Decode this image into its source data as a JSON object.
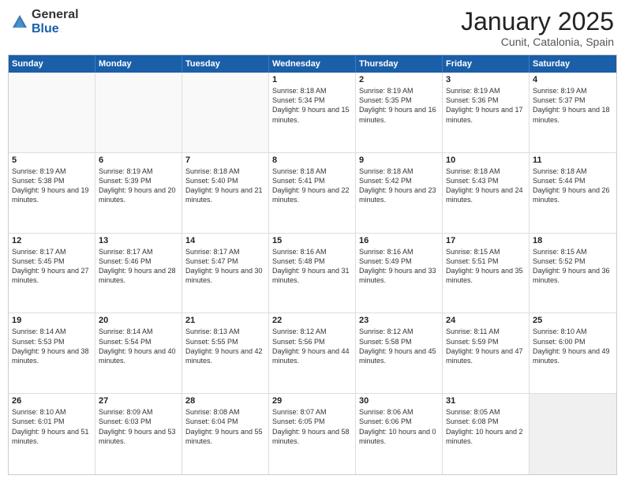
{
  "logo": {
    "general": "General",
    "blue": "Blue"
  },
  "header": {
    "month": "January 2025",
    "location": "Cunit, Catalonia, Spain"
  },
  "days": [
    "Sunday",
    "Monday",
    "Tuesday",
    "Wednesday",
    "Thursday",
    "Friday",
    "Saturday"
  ],
  "weeks": [
    [
      {
        "day": "",
        "empty": true
      },
      {
        "day": "",
        "empty": true
      },
      {
        "day": "",
        "empty": true
      },
      {
        "day": "1",
        "sunrise": "Sunrise: 8:18 AM",
        "sunset": "Sunset: 5:34 PM",
        "daylight": "Daylight: 9 hours and 15 minutes."
      },
      {
        "day": "2",
        "sunrise": "Sunrise: 8:19 AM",
        "sunset": "Sunset: 5:35 PM",
        "daylight": "Daylight: 9 hours and 16 minutes."
      },
      {
        "day": "3",
        "sunrise": "Sunrise: 8:19 AM",
        "sunset": "Sunset: 5:36 PM",
        "daylight": "Daylight: 9 hours and 17 minutes."
      },
      {
        "day": "4",
        "sunrise": "Sunrise: 8:19 AM",
        "sunset": "Sunset: 5:37 PM",
        "daylight": "Daylight: 9 hours and 18 minutes."
      }
    ],
    [
      {
        "day": "5",
        "sunrise": "Sunrise: 8:19 AM",
        "sunset": "Sunset: 5:38 PM",
        "daylight": "Daylight: 9 hours and 19 minutes."
      },
      {
        "day": "6",
        "sunrise": "Sunrise: 8:19 AM",
        "sunset": "Sunset: 5:39 PM",
        "daylight": "Daylight: 9 hours and 20 minutes."
      },
      {
        "day": "7",
        "sunrise": "Sunrise: 8:18 AM",
        "sunset": "Sunset: 5:40 PM",
        "daylight": "Daylight: 9 hours and 21 minutes."
      },
      {
        "day": "8",
        "sunrise": "Sunrise: 8:18 AM",
        "sunset": "Sunset: 5:41 PM",
        "daylight": "Daylight: 9 hours and 22 minutes."
      },
      {
        "day": "9",
        "sunrise": "Sunrise: 8:18 AM",
        "sunset": "Sunset: 5:42 PM",
        "daylight": "Daylight: 9 hours and 23 minutes."
      },
      {
        "day": "10",
        "sunrise": "Sunrise: 8:18 AM",
        "sunset": "Sunset: 5:43 PM",
        "daylight": "Daylight: 9 hours and 24 minutes."
      },
      {
        "day": "11",
        "sunrise": "Sunrise: 8:18 AM",
        "sunset": "Sunset: 5:44 PM",
        "daylight": "Daylight: 9 hours and 26 minutes."
      }
    ],
    [
      {
        "day": "12",
        "sunrise": "Sunrise: 8:17 AM",
        "sunset": "Sunset: 5:45 PM",
        "daylight": "Daylight: 9 hours and 27 minutes."
      },
      {
        "day": "13",
        "sunrise": "Sunrise: 8:17 AM",
        "sunset": "Sunset: 5:46 PM",
        "daylight": "Daylight: 9 hours and 28 minutes."
      },
      {
        "day": "14",
        "sunrise": "Sunrise: 8:17 AM",
        "sunset": "Sunset: 5:47 PM",
        "daylight": "Daylight: 9 hours and 30 minutes."
      },
      {
        "day": "15",
        "sunrise": "Sunrise: 8:16 AM",
        "sunset": "Sunset: 5:48 PM",
        "daylight": "Daylight: 9 hours and 31 minutes."
      },
      {
        "day": "16",
        "sunrise": "Sunrise: 8:16 AM",
        "sunset": "Sunset: 5:49 PM",
        "daylight": "Daylight: 9 hours and 33 minutes."
      },
      {
        "day": "17",
        "sunrise": "Sunrise: 8:15 AM",
        "sunset": "Sunset: 5:51 PM",
        "daylight": "Daylight: 9 hours and 35 minutes."
      },
      {
        "day": "18",
        "sunrise": "Sunrise: 8:15 AM",
        "sunset": "Sunset: 5:52 PM",
        "daylight": "Daylight: 9 hours and 36 minutes."
      }
    ],
    [
      {
        "day": "19",
        "sunrise": "Sunrise: 8:14 AM",
        "sunset": "Sunset: 5:53 PM",
        "daylight": "Daylight: 9 hours and 38 minutes."
      },
      {
        "day": "20",
        "sunrise": "Sunrise: 8:14 AM",
        "sunset": "Sunset: 5:54 PM",
        "daylight": "Daylight: 9 hours and 40 minutes."
      },
      {
        "day": "21",
        "sunrise": "Sunrise: 8:13 AM",
        "sunset": "Sunset: 5:55 PM",
        "daylight": "Daylight: 9 hours and 42 minutes."
      },
      {
        "day": "22",
        "sunrise": "Sunrise: 8:12 AM",
        "sunset": "Sunset: 5:56 PM",
        "daylight": "Daylight: 9 hours and 44 minutes."
      },
      {
        "day": "23",
        "sunrise": "Sunrise: 8:12 AM",
        "sunset": "Sunset: 5:58 PM",
        "daylight": "Daylight: 9 hours and 45 minutes."
      },
      {
        "day": "24",
        "sunrise": "Sunrise: 8:11 AM",
        "sunset": "Sunset: 5:59 PM",
        "daylight": "Daylight: 9 hours and 47 minutes."
      },
      {
        "day": "25",
        "sunrise": "Sunrise: 8:10 AM",
        "sunset": "Sunset: 6:00 PM",
        "daylight": "Daylight: 9 hours and 49 minutes."
      }
    ],
    [
      {
        "day": "26",
        "sunrise": "Sunrise: 8:10 AM",
        "sunset": "Sunset: 6:01 PM",
        "daylight": "Daylight: 9 hours and 51 minutes."
      },
      {
        "day": "27",
        "sunrise": "Sunrise: 8:09 AM",
        "sunset": "Sunset: 6:03 PM",
        "daylight": "Daylight: 9 hours and 53 minutes."
      },
      {
        "day": "28",
        "sunrise": "Sunrise: 8:08 AM",
        "sunset": "Sunset: 6:04 PM",
        "daylight": "Daylight: 9 hours and 55 minutes."
      },
      {
        "day": "29",
        "sunrise": "Sunrise: 8:07 AM",
        "sunset": "Sunset: 6:05 PM",
        "daylight": "Daylight: 9 hours and 58 minutes."
      },
      {
        "day": "30",
        "sunrise": "Sunrise: 8:06 AM",
        "sunset": "Sunset: 6:06 PM",
        "daylight": "Daylight: 10 hours and 0 minutes."
      },
      {
        "day": "31",
        "sunrise": "Sunrise: 8:05 AM",
        "sunset": "Sunset: 6:08 PM",
        "daylight": "Daylight: 10 hours and 2 minutes."
      },
      {
        "day": "",
        "empty": true,
        "shaded": true
      }
    ]
  ]
}
